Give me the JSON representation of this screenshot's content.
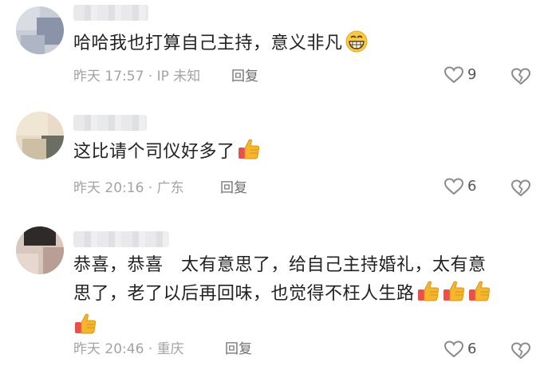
{
  "comments": [
    {
      "text": "哈哈我也打算自己主持，意义非凡",
      "time_location": "昨天 17:57 · IP 未知",
      "reply_label": "回复",
      "likes": "9",
      "emoji": [
        "grin-emoji"
      ]
    },
    {
      "text": "这比请个司仪好多了",
      "time_location": "昨天 20:16 · 广东",
      "reply_label": "回复",
      "likes": "6",
      "emoji": [
        "thumbs-up-emoji"
      ]
    },
    {
      "text_line1": "恭喜，恭喜　太有意思了，给自己主持婚礼，太有意",
      "text_line2": "思了，老了以后再回味，也觉得不枉人生路",
      "time_location": "昨天 20:46 · 重庆",
      "reply_label": "回复",
      "likes": "6",
      "emoji": [
        "thumbs-up-emoji",
        "thumbs-up-emoji",
        "thumbs-up-emoji",
        "thumbs-up-emoji"
      ]
    }
  ],
  "colors": {
    "text": "#222222",
    "meta": "#a3a3a8",
    "reply": "#6f6f75",
    "thumb": "#f5b52c",
    "cuff": "#e8514a"
  }
}
